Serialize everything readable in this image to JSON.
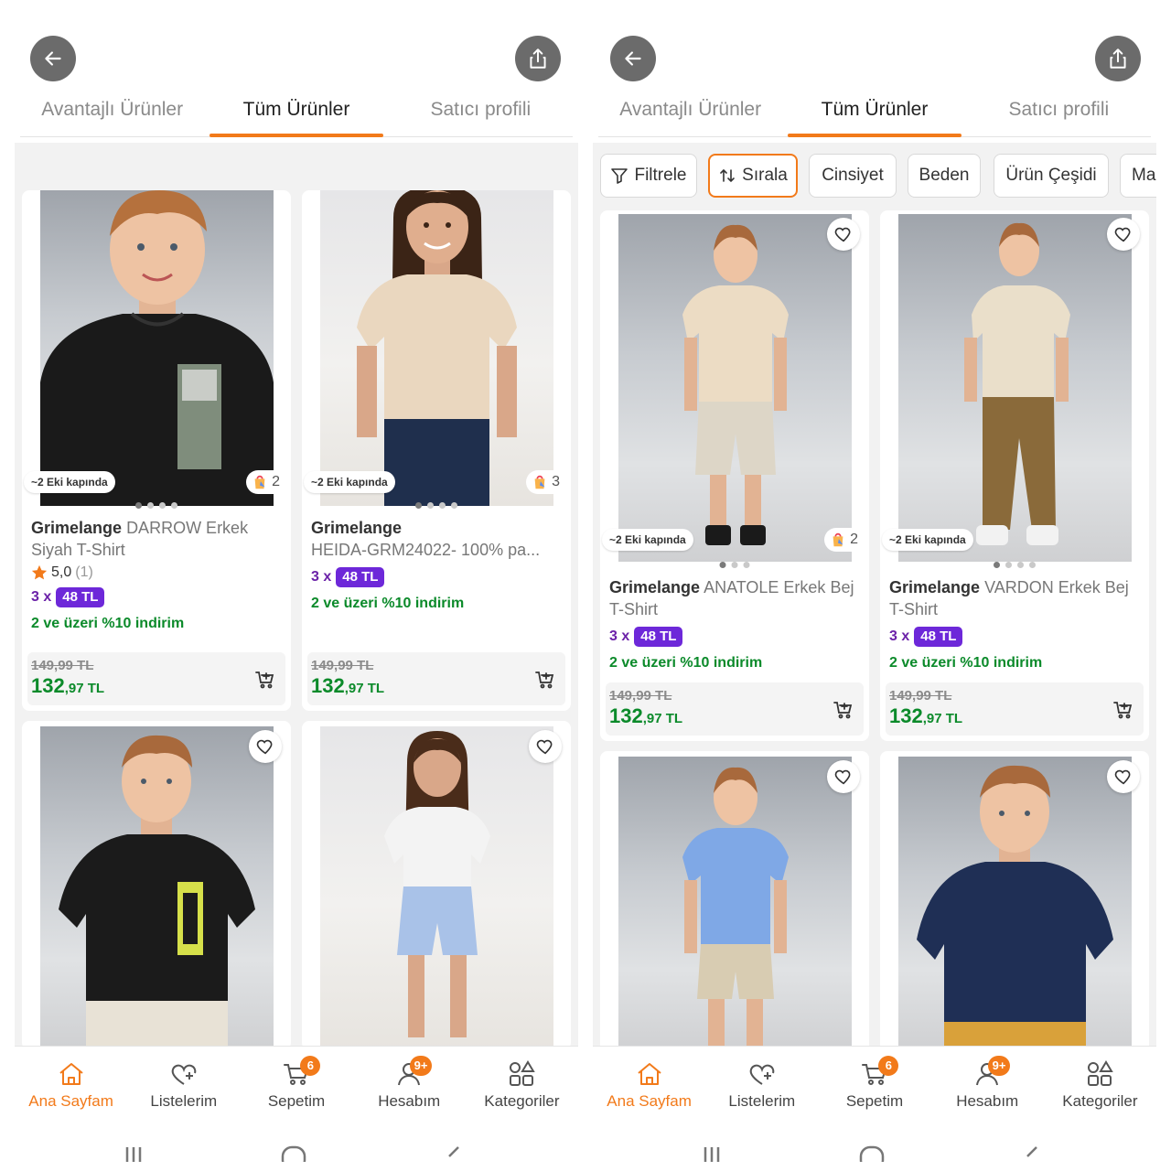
{
  "colors": {
    "accent": "#f27a1a",
    "price_green": "#0b8a2a",
    "installment_purple": "#6d28d9",
    "header_button": "#6b6b6b"
  },
  "left": {
    "tabs": [
      "Avantajlı Ürünler",
      "Tüm Ürünler",
      "Satıcı profili"
    ],
    "active_tab": "Tüm Ürünler",
    "products": [
      {
        "brand": "Grimelange",
        "model": "DARROW Erkek Siyah T-Shirt",
        "rating": "5,0",
        "rating_count": "(1)",
        "delivery": "~2 Eki kapında",
        "badge_count": "2",
        "installment_prefix": "3 x",
        "installment_amount": "48 TL",
        "promo": "2 ve üzeri %10 indirim",
        "old_price": "149,99 TL",
        "price_int": "132",
        "price_dec": ",97 TL",
        "image": "boy-black-tshirt"
      },
      {
        "brand": "Grimelange",
        "model": "HEIDA-GRM24022- 100% pa...",
        "delivery": "~2 Eki kapında",
        "badge_count": "3",
        "installment_prefix": "3 x",
        "installment_amount": "48 TL",
        "promo": "2 ve üzeri %10 indirim",
        "old_price": "149,99 TL",
        "price_int": "132",
        "price_dec": ",97 TL",
        "image": "girl-beige-tshirt"
      },
      {
        "image": "boy-black-graphic-tshirt"
      },
      {
        "image": "girl-white-tshirt-blue-shorts"
      }
    ]
  },
  "right": {
    "tabs": [
      "Avantajlı Ürünler",
      "Tüm Ürünler",
      "Satıcı profili"
    ],
    "active_tab": "Tüm Ürünler",
    "filters": {
      "filter_label": "Filtrele",
      "sort_label": "Sırala",
      "chips": [
        "Cinsiyet",
        "Beden",
        "Ürün Çeşidi",
        "Ma"
      ]
    },
    "products": [
      {
        "brand": "Grimelange",
        "model": "ANATOLE Erkek Bej T-Shirt",
        "delivery": "~2 Eki kapında",
        "badge_count": "2",
        "installment_prefix": "3 x",
        "installment_amount": "48 TL",
        "promo": "2 ve üzeri %10 indirim",
        "old_price": "149,99 TL",
        "price_int": "132",
        "price_dec": ",97 TL",
        "image": "boy-beige-tshirt-shorts"
      },
      {
        "brand": "Grimelange",
        "model": "VARDON Erkek Bej T-Shirt",
        "delivery": "~2 Eki kapında",
        "installment_prefix": "3 x",
        "installment_amount": "48 TL",
        "promo": "2 ve üzeri %10 indirim",
        "old_price": "149,99 TL",
        "price_int": "132",
        "price_dec": ",97 TL",
        "image": "boy-beige-tshirt-khaki-pants"
      },
      {
        "image": "boy-blue-tshirt"
      },
      {
        "image": "boy-navy-tshirt"
      }
    ]
  },
  "bottom_nav": {
    "items": [
      {
        "label": "Ana Sayfam",
        "icon": "home-icon",
        "active": true
      },
      {
        "label": "Listelerim",
        "icon": "heart-list-icon"
      },
      {
        "label": "Sepetim",
        "icon": "cart-icon",
        "badge": "6"
      },
      {
        "label": "Hesabım",
        "icon": "user-icon",
        "badge": "9+"
      },
      {
        "label": "Kategoriler",
        "icon": "categories-icon"
      }
    ]
  }
}
